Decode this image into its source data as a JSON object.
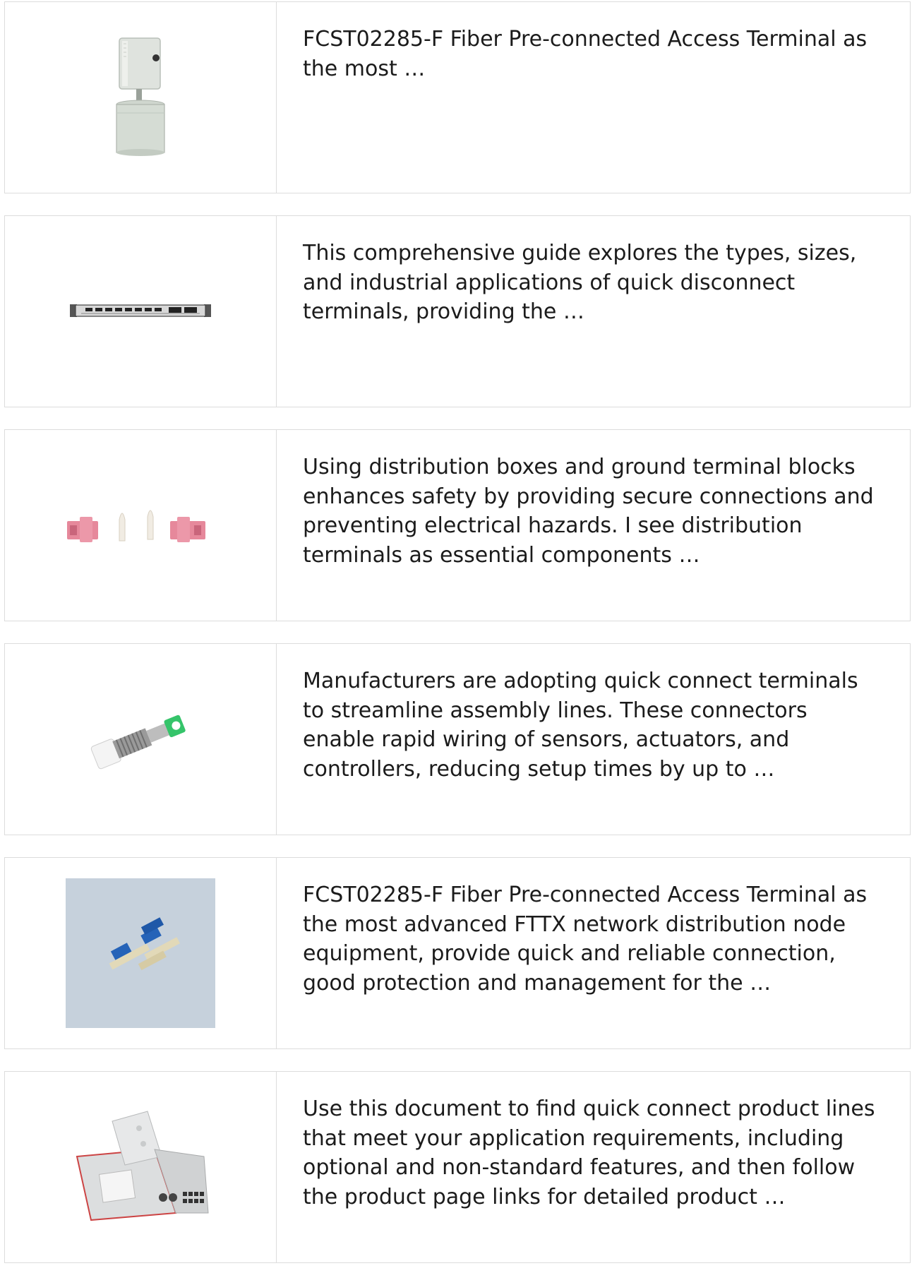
{
  "items": [
    {
      "thumbnail_icon": "fiber-access-terminal-pole-icon",
      "description": "FCST02285-F Fiber Pre-connected Access Terminal as the most …"
    },
    {
      "thumbnail_icon": "rack-patch-panel-icon",
      "description": "This comprehensive guide explores the types, sizes, and industrial applications of quick disconnect terminals, providing the …"
    },
    {
      "thumbnail_icon": "pink-fiber-adapters-icon",
      "description": "Using distribution boxes and ground terminal blocks enhances safety by providing secure connections and preventing electrical hazards. I see distribution terminals as essential components …"
    },
    {
      "thumbnail_icon": "fc-fiber-attenuator-icon",
      "description": "Manufacturers are adopting quick connect terminals to streamline assembly lines. These connectors enable rapid wiring of sensors, actuators, and controllers, reducing setup times by up to …"
    },
    {
      "thumbnail_icon": "blue-sc-adapters-icon",
      "description": "FCST02285-F Fiber Pre-connected Access Terminal as the most advanced FTTX network distribution node equipment, provide quick and reliable connection, good protection and management for the …"
    },
    {
      "thumbnail_icon": "open-distribution-box-icon",
      "description": "Use this document to find quick connect product lines that meet your application requirements, including optional and non-standard features, and then follow the product page links for detailed product …"
    }
  ]
}
